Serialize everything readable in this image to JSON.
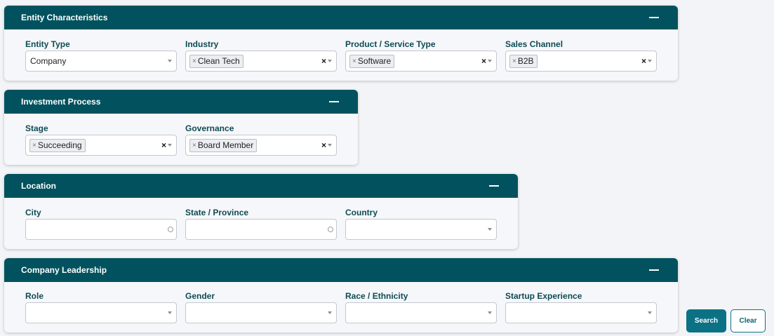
{
  "sections": {
    "entity": {
      "title": "Entity Characteristics",
      "entity_type": {
        "label": "Entity Type",
        "value": "Company"
      },
      "industry": {
        "label": "Industry",
        "chips": [
          "Clean Tech"
        ]
      },
      "product": {
        "label": "Product / Service Type",
        "chips": [
          "Software"
        ]
      },
      "sales": {
        "label": "Sales Channel",
        "chips": [
          "B2B"
        ]
      }
    },
    "investment": {
      "title": "Investment Process",
      "stage": {
        "label": "Stage",
        "chips": [
          "Succeeding"
        ]
      },
      "governance": {
        "label": "Governance",
        "chips": [
          "Board Member"
        ]
      }
    },
    "location": {
      "title": "Location",
      "city": {
        "label": "City",
        "value": ""
      },
      "state": {
        "label": "State / Province",
        "value": ""
      },
      "country": {
        "label": "Country",
        "value": ""
      }
    },
    "leadership": {
      "title": "Company Leadership",
      "role": {
        "label": "Role",
        "value": ""
      },
      "gender": {
        "label": "Gender",
        "value": ""
      },
      "race": {
        "label": "Race / Ethnicity",
        "value": ""
      },
      "startup": {
        "label": "Startup Experience",
        "value": ""
      }
    }
  },
  "chip_remove": "×",
  "clear_all": "×",
  "buttons": {
    "search": "Search",
    "clear": "Clear"
  },
  "colors": {
    "header": "#01525e",
    "label": "#0d4b53",
    "search": "#0b7285"
  },
  "icons": [
    "minus-icon",
    "chevron-down-icon",
    "circle-icon",
    "close-icon"
  ]
}
